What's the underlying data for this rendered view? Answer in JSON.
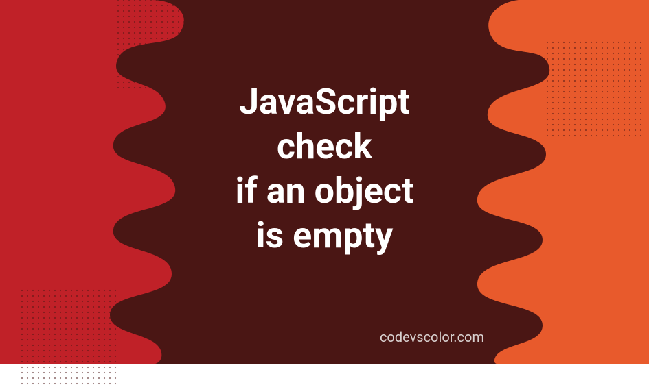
{
  "title": {
    "line1": "JavaScript",
    "line2": "check",
    "line3": "if an object",
    "line4": "is empty"
  },
  "watermark": "codevscolor.com",
  "colors": {
    "background_dark": "#4a1614",
    "left_red": "#c02128",
    "right_orange": "#e85a2c",
    "text": "#ffffff",
    "watermark_text": "#d8d0cf"
  }
}
